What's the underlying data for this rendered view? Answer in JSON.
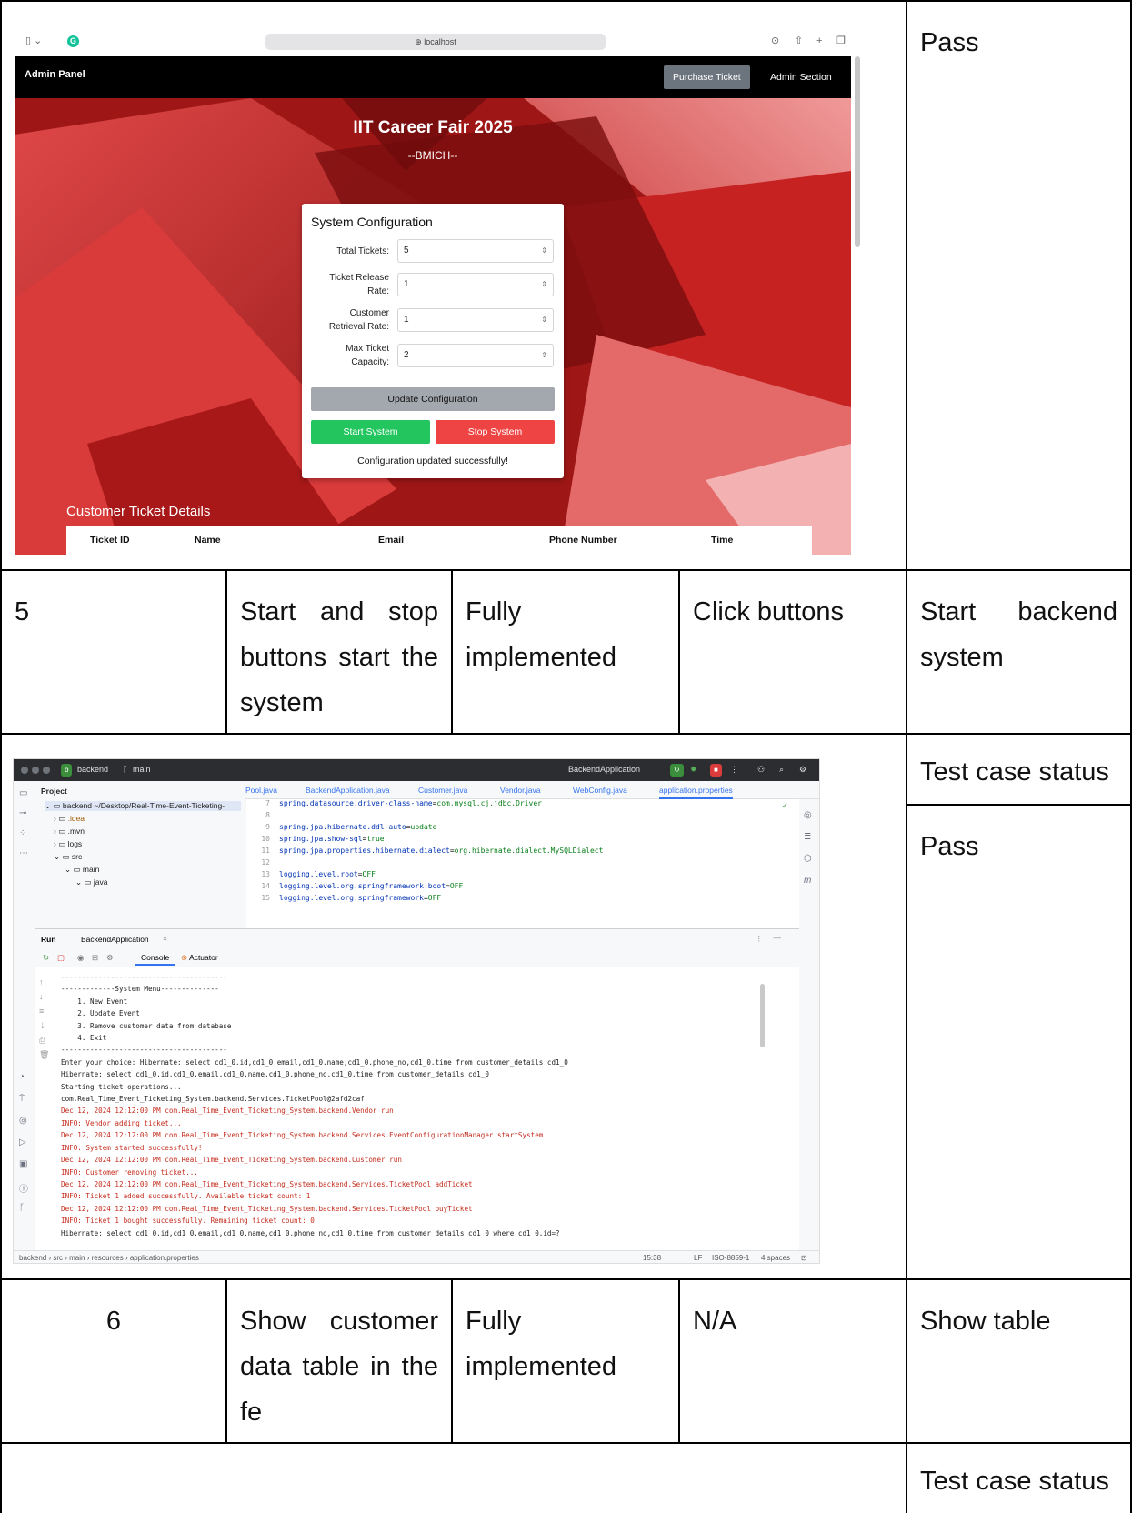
{
  "row_a": {
    "status": "Pass"
  },
  "browser": {
    "url": "localhost",
    "brand": "Admin Panel",
    "nav": [
      "Purchase Ticket",
      "Admin Section"
    ],
    "hero_title": "IIT Career Fair 2025",
    "hero_subtitle": "--BMICH--",
    "config": {
      "title": "System Configuration",
      "fields": [
        {
          "label_1": "Total Tickets:",
          "label_2": "",
          "value": "5"
        },
        {
          "label_1": "Ticket Release",
          "label_2": "Rate:",
          "value": "1"
        },
        {
          "label_1": "Customer",
          "label_2": "Retrieval Rate:",
          "value": "1"
        },
        {
          "label_1": "Max Ticket",
          "label_2": "Capacity:",
          "value": "2"
        }
      ],
      "update_label": "Update Configuration",
      "start_label": "Start System",
      "stop_label": "Stop System",
      "message": "Configuration updated successfully!"
    },
    "customer_table": {
      "title": "Customer Ticket Details",
      "headers": [
        "Ticket ID",
        "Name",
        "Email",
        "Phone Number",
        "Time"
      ]
    }
  },
  "row5": {
    "number": "5",
    "description": "Start and stop buttons start the system",
    "status": "Fully implemented",
    "steps": "Click buttons",
    "expected": "Start backend system"
  },
  "row_b": {
    "header": "Test case status",
    "status": "Pass"
  },
  "ide": {
    "project": "backend",
    "branch": "main",
    "run_config": "BackendApplication",
    "tabs": [
      "Pool.java",
      "BackendApplication.java",
      "Customer.java",
      "Vendor.java",
      "WebConfig.java",
      "application.properties"
    ],
    "tree": [
      "Project",
      "backend ~/Desktop/Real-Time-Event-Ticketing-",
      ".idea",
      ".mvn",
      "logs",
      "src",
      "main",
      "java"
    ],
    "code": [
      {
        "ln": "7",
        "key": "spring.datasource.driver-class-name",
        "val": "com.mysql.cj.jdbc.Driver"
      },
      {
        "ln": "8",
        "key": "",
        "val": ""
      },
      {
        "ln": "9",
        "key": "spring.jpa.hibernate.ddl-auto",
        "val": "update"
      },
      {
        "ln": "10",
        "key": "spring.jpa.show-sql",
        "val": "true"
      },
      {
        "ln": "11",
        "key": "spring.jpa.properties.hibernate.dialect",
        "val": "org.hibernate.dialect.MySQLDialect"
      },
      {
        "ln": "12",
        "key": "",
        "val": ""
      },
      {
        "ln": "13",
        "key": "logging.level.root",
        "val": "OFF"
      },
      {
        "ln": "14",
        "key": "logging.level.org.springframework.boot",
        "val": "OFF"
      },
      {
        "ln": "15",
        "key": "logging.level.org.springframework",
        "val": "OFF"
      }
    ],
    "run_label": "Run",
    "console_tab": "Console",
    "actuator_tab": "Actuator",
    "console": [
      {
        "t": "----------------------------------------",
        "red": false
      },
      {
        "t": "-------------System Menu--------------",
        "red": false
      },
      {
        "t": "    1. New Event",
        "red": false
      },
      {
        "t": "    2. Update Event",
        "red": false
      },
      {
        "t": "    3. Remove customer data from database",
        "red": false
      },
      {
        "t": "    4. Exit",
        "red": false
      },
      {
        "t": "",
        "red": false
      },
      {
        "t": "----------------------------------------",
        "red": false
      },
      {
        "t": "Enter your choice: Hibernate: select cd1_0.id,cd1_0.email,cd1_0.name,cd1_0.phone_no,cd1_0.time from customer_details cd1_0",
        "red": false
      },
      {
        "t": "Hibernate: select cd1_0.id,cd1_0.email,cd1_0.name,cd1_0.phone_no,cd1_0.time from customer_details cd1_0",
        "red": false
      },
      {
        "t": "Starting ticket operations...",
        "red": false
      },
      {
        "t": "com.Real_Time_Event_Ticketing_System.backend.Services.TicketPool@2afd2caf",
        "red": false
      },
      {
        "t": "Dec 12, 2024 12:12:00 PM com.Real_Time_Event_Ticketing_System.backend.Vendor run",
        "red": true
      },
      {
        "t": "INFO: Vendor adding ticket...",
        "red": true
      },
      {
        "t": "Dec 12, 2024 12:12:00 PM com.Real_Time_Event_Ticketing_System.backend.Services.EventConfigurationManager startSystem",
        "red": true
      },
      {
        "t": "INFO: System started successfully!",
        "red": true
      },
      {
        "t": "Dec 12, 2024 12:12:00 PM com.Real_Time_Event_Ticketing_System.backend.Customer run",
        "red": true
      },
      {
        "t": "INFO: Customer removing ticket...",
        "red": true
      },
      {
        "t": "Dec 12, 2024 12:12:00 PM com.Real_Time_Event_Ticketing_System.backend.Services.TicketPool addTicket",
        "red": true
      },
      {
        "t": "INFO: Ticket 1 added successfully. Available ticket count: 1",
        "red": true
      },
      {
        "t": "Dec 12, 2024 12:12:00 PM com.Real_Time_Event_Ticketing_System.backend.Services.TicketPool buyTicket",
        "red": true
      },
      {
        "t": "INFO: Ticket 1 bought successfully. Remaining ticket count: 0",
        "red": true
      },
      {
        "t": "Hibernate: select cd1_0.id,cd1_0.email,cd1_0.name,cd1_0.phone_no,cd1_0.time from customer_details cd1_0 where cd1_0.id=?",
        "red": false
      }
    ],
    "status_bar": {
      "breadcrumb": [
        "backend",
        "src",
        "main",
        "resources",
        "application.properties"
      ],
      "position": "15:38",
      "line_sep": "LF",
      "encoding": "ISO-8859-1",
      "indent": "4 spaces"
    }
  },
  "row6": {
    "number": "6",
    "description": "Show customer data table in the fe",
    "status": "Fully implemented",
    "steps": "N/A",
    "expected": "Show table"
  },
  "row_c": {
    "header": "Test case status"
  },
  "colors": {
    "hero_red": "#b51b1b",
    "start_green": "#22c55e",
    "stop_red": "#ef4444",
    "ide_dark": "#2b2d30"
  }
}
